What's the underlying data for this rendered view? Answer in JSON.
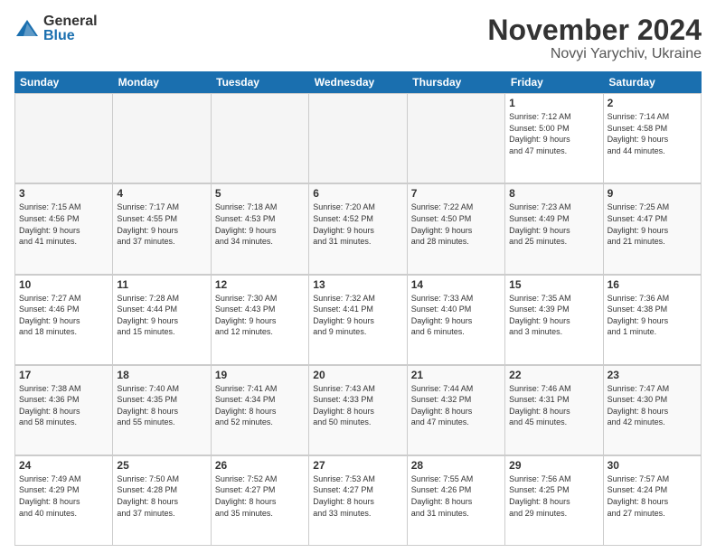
{
  "logo": {
    "general": "General",
    "blue": "Blue"
  },
  "title": "November 2024",
  "location": "Novyi Yarychiv, Ukraine",
  "header": {
    "days": [
      "Sunday",
      "Monday",
      "Tuesday",
      "Wednesday",
      "Thursday",
      "Friday",
      "Saturday"
    ]
  },
  "weeks": [
    {
      "alt": false,
      "cells": [
        {
          "day": null,
          "info": null
        },
        {
          "day": null,
          "info": null
        },
        {
          "day": null,
          "info": null
        },
        {
          "day": null,
          "info": null
        },
        {
          "day": null,
          "info": null
        },
        {
          "day": "1",
          "info": "Sunrise: 7:12 AM\nSunset: 5:00 PM\nDaylight: 9 hours\nand 47 minutes."
        },
        {
          "day": "2",
          "info": "Sunrise: 7:14 AM\nSunset: 4:58 PM\nDaylight: 9 hours\nand 44 minutes."
        }
      ]
    },
    {
      "alt": true,
      "cells": [
        {
          "day": "3",
          "info": "Sunrise: 7:15 AM\nSunset: 4:56 PM\nDaylight: 9 hours\nand 41 minutes."
        },
        {
          "day": "4",
          "info": "Sunrise: 7:17 AM\nSunset: 4:55 PM\nDaylight: 9 hours\nand 37 minutes."
        },
        {
          "day": "5",
          "info": "Sunrise: 7:18 AM\nSunset: 4:53 PM\nDaylight: 9 hours\nand 34 minutes."
        },
        {
          "day": "6",
          "info": "Sunrise: 7:20 AM\nSunset: 4:52 PM\nDaylight: 9 hours\nand 31 minutes."
        },
        {
          "day": "7",
          "info": "Sunrise: 7:22 AM\nSunset: 4:50 PM\nDaylight: 9 hours\nand 28 minutes."
        },
        {
          "day": "8",
          "info": "Sunrise: 7:23 AM\nSunset: 4:49 PM\nDaylight: 9 hours\nand 25 minutes."
        },
        {
          "day": "9",
          "info": "Sunrise: 7:25 AM\nSunset: 4:47 PM\nDaylight: 9 hours\nand 21 minutes."
        }
      ]
    },
    {
      "alt": false,
      "cells": [
        {
          "day": "10",
          "info": "Sunrise: 7:27 AM\nSunset: 4:46 PM\nDaylight: 9 hours\nand 18 minutes."
        },
        {
          "day": "11",
          "info": "Sunrise: 7:28 AM\nSunset: 4:44 PM\nDaylight: 9 hours\nand 15 minutes."
        },
        {
          "day": "12",
          "info": "Sunrise: 7:30 AM\nSunset: 4:43 PM\nDaylight: 9 hours\nand 12 minutes."
        },
        {
          "day": "13",
          "info": "Sunrise: 7:32 AM\nSunset: 4:41 PM\nDaylight: 9 hours\nand 9 minutes."
        },
        {
          "day": "14",
          "info": "Sunrise: 7:33 AM\nSunset: 4:40 PM\nDaylight: 9 hours\nand 6 minutes."
        },
        {
          "day": "15",
          "info": "Sunrise: 7:35 AM\nSunset: 4:39 PM\nDaylight: 9 hours\nand 3 minutes."
        },
        {
          "day": "16",
          "info": "Sunrise: 7:36 AM\nSunset: 4:38 PM\nDaylight: 9 hours\nand 1 minute."
        }
      ]
    },
    {
      "alt": true,
      "cells": [
        {
          "day": "17",
          "info": "Sunrise: 7:38 AM\nSunset: 4:36 PM\nDaylight: 8 hours\nand 58 minutes."
        },
        {
          "day": "18",
          "info": "Sunrise: 7:40 AM\nSunset: 4:35 PM\nDaylight: 8 hours\nand 55 minutes."
        },
        {
          "day": "19",
          "info": "Sunrise: 7:41 AM\nSunset: 4:34 PM\nDaylight: 8 hours\nand 52 minutes."
        },
        {
          "day": "20",
          "info": "Sunrise: 7:43 AM\nSunset: 4:33 PM\nDaylight: 8 hours\nand 50 minutes."
        },
        {
          "day": "21",
          "info": "Sunrise: 7:44 AM\nSunset: 4:32 PM\nDaylight: 8 hours\nand 47 minutes."
        },
        {
          "day": "22",
          "info": "Sunrise: 7:46 AM\nSunset: 4:31 PM\nDaylight: 8 hours\nand 45 minutes."
        },
        {
          "day": "23",
          "info": "Sunrise: 7:47 AM\nSunset: 4:30 PM\nDaylight: 8 hours\nand 42 minutes."
        }
      ]
    },
    {
      "alt": false,
      "cells": [
        {
          "day": "24",
          "info": "Sunrise: 7:49 AM\nSunset: 4:29 PM\nDaylight: 8 hours\nand 40 minutes."
        },
        {
          "day": "25",
          "info": "Sunrise: 7:50 AM\nSunset: 4:28 PM\nDaylight: 8 hours\nand 37 minutes."
        },
        {
          "day": "26",
          "info": "Sunrise: 7:52 AM\nSunset: 4:27 PM\nDaylight: 8 hours\nand 35 minutes."
        },
        {
          "day": "27",
          "info": "Sunrise: 7:53 AM\nSunset: 4:27 PM\nDaylight: 8 hours\nand 33 minutes."
        },
        {
          "day": "28",
          "info": "Sunrise: 7:55 AM\nSunset: 4:26 PM\nDaylight: 8 hours\nand 31 minutes."
        },
        {
          "day": "29",
          "info": "Sunrise: 7:56 AM\nSunset: 4:25 PM\nDaylight: 8 hours\nand 29 minutes."
        },
        {
          "day": "30",
          "info": "Sunrise: 7:57 AM\nSunset: 4:24 PM\nDaylight: 8 hours\nand 27 minutes."
        }
      ]
    }
  ]
}
